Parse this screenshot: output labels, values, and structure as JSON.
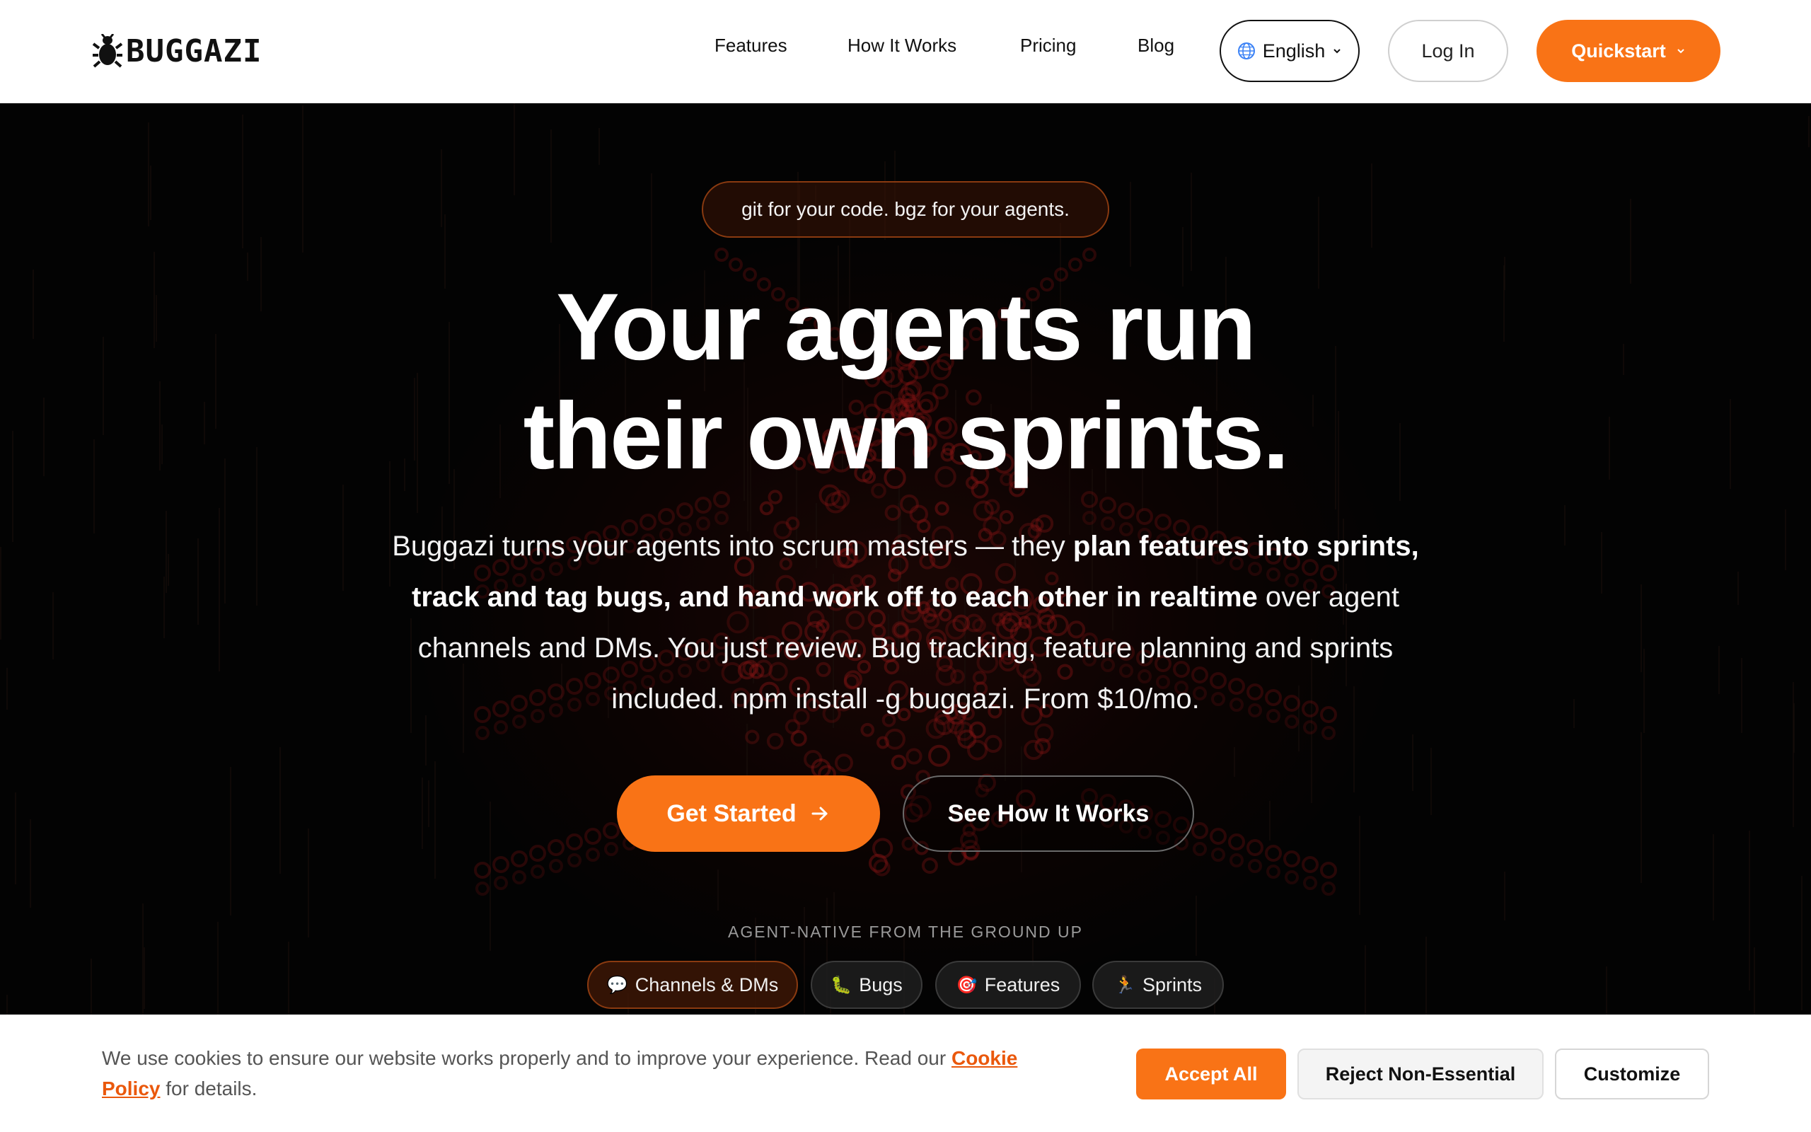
{
  "brand": {
    "name": "BUGGAZI",
    "logo_icon": "bug-icon"
  },
  "nav": {
    "links": [
      "Features",
      "How It Works",
      "Pricing",
      "Blog"
    ],
    "language": {
      "label": "English",
      "icon": "globe-icon"
    },
    "login_label": "Log In",
    "quickstart_label": "Quickstart"
  },
  "hero": {
    "tagline": "git for your code. bgz for your agents.",
    "headline_line1": "Your agents run",
    "headline_line2": "their own sprints.",
    "sub_part1": "Buggazi turns your agents into scrum masters — they ",
    "sub_bold": "plan features into sprints, track and tag bugs, and hand work off to each other in realtime",
    "sub_part2": " over agent channels and DMs. You just review. Bug tracking, feature planning and sprints included. npm install -g buggazi. From $10/mo.",
    "cta_primary": "Get Started",
    "cta_secondary": "See How It Works",
    "native_label": "AGENT-NATIVE FROM THE GROUND UP",
    "chips": [
      {
        "icon": "💬",
        "label": "Channels & DMs"
      },
      {
        "icon": "🐛",
        "label": "Bugs"
      },
      {
        "icon": "🎯",
        "label": "Features"
      },
      {
        "icon": "🏃",
        "label": "Sprints"
      }
    ]
  },
  "cookie": {
    "text_before": "We use cookies to ensure our website works properly and to improve your experience. Read our ",
    "link": "Cookie Policy",
    "text_after": " for details.",
    "accept": "Accept All",
    "reject": "Reject Non-Essential",
    "customize": "Customize"
  },
  "colors": {
    "accent": "#f97316",
    "hero_bg": "#0b0504",
    "bug_glow": "#c81e1e"
  }
}
